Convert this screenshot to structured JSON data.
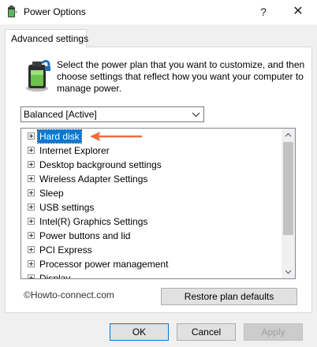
{
  "window": {
    "title": "Power Options",
    "help_glyph": "?",
    "close_glyph": "✕"
  },
  "tab": {
    "label": "Advanced settings"
  },
  "description": "Select the power plan that you want to customize, and then choose settings that reflect how you want your computer to manage power.",
  "plan_select": {
    "value": "Balanced [Active]"
  },
  "settings_tree": {
    "items": [
      {
        "label": "Hard disk",
        "selected": true
      },
      {
        "label": "Internet Explorer"
      },
      {
        "label": "Desktop background settings"
      },
      {
        "label": "Wireless Adapter Settings"
      },
      {
        "label": "Sleep"
      },
      {
        "label": "USB settings"
      },
      {
        "label": "Intel(R) Graphics Settings"
      },
      {
        "label": "Power buttons and lid"
      },
      {
        "label": "PCI Express"
      },
      {
        "label": "Processor power management"
      },
      {
        "label": "Display"
      }
    ]
  },
  "watermark": "©Howto-connect.com",
  "buttons": {
    "restore": "Restore plan defaults",
    "ok": "OK",
    "cancel": "Cancel",
    "apply": "Apply"
  },
  "colors": {
    "selection": "#0078d7",
    "annotation_arrow": "#f26b3a"
  },
  "icons": {
    "app": "power-options-icon",
    "plan": "battery-plug-icon"
  }
}
